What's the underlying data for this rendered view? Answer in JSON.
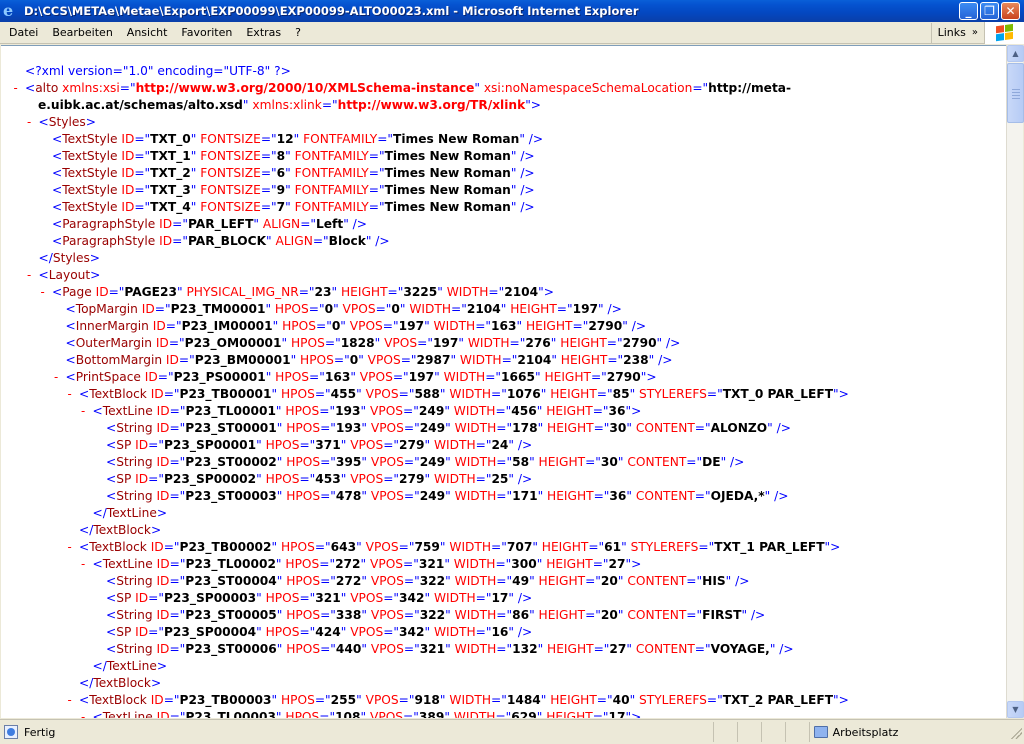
{
  "window": {
    "title": "D:\\CCS\\METAe\\Metae\\Export\\EXP00099\\EXP00099-ALTO00023.xml - Microsoft Internet Explorer",
    "minimize": "_",
    "maximize": "❐",
    "close": "✕"
  },
  "menu": {
    "items": [
      "Datei",
      "Bearbeiten",
      "Ansicht",
      "Favoriten",
      "Extras",
      "?"
    ],
    "links": "Links",
    "links_chevron": "»"
  },
  "status": {
    "text": "Fertig",
    "zone": "Arbeitsplatz"
  },
  "colors": {
    "tag_name": "#990000",
    "attr_name": "#ff0000",
    "markup": "#0000ff",
    "collapse_marker": "#ff0000"
  },
  "xml_lines": [
    {
      "indent": 0,
      "marker": "",
      "kind": "pi",
      "text": "<?xml version=\"1.0\" encoding=\"UTF-8\" ?>"
    },
    {
      "indent": 0,
      "marker": "-",
      "kind": "alto1",
      "text": "alto"
    },
    {
      "indent": 0,
      "marker": "",
      "kind": "alto2",
      "text": ""
    },
    {
      "indent": 1,
      "marker": "-",
      "kind": "open",
      "tag": "Styles",
      "attrs": []
    },
    {
      "indent": 2,
      "marker": "",
      "kind": "empty",
      "tag": "TextStyle",
      "attrs": [
        [
          "ID",
          "TXT_0"
        ],
        [
          "FONTSIZE",
          "12"
        ],
        [
          "FONTFAMILY",
          "Times New Roman"
        ]
      ]
    },
    {
      "indent": 2,
      "marker": "",
      "kind": "empty",
      "tag": "TextStyle",
      "attrs": [
        [
          "ID",
          "TXT_1"
        ],
        [
          "FONTSIZE",
          "8"
        ],
        [
          "FONTFAMILY",
          "Times New Roman"
        ]
      ]
    },
    {
      "indent": 2,
      "marker": "",
      "kind": "empty",
      "tag": "TextStyle",
      "attrs": [
        [
          "ID",
          "TXT_2"
        ],
        [
          "FONTSIZE",
          "6"
        ],
        [
          "FONTFAMILY",
          "Times New Roman"
        ]
      ]
    },
    {
      "indent": 2,
      "marker": "",
      "kind": "empty",
      "tag": "TextStyle",
      "attrs": [
        [
          "ID",
          "TXT_3"
        ],
        [
          "FONTSIZE",
          "9"
        ],
        [
          "FONTFAMILY",
          "Times New Roman"
        ]
      ]
    },
    {
      "indent": 2,
      "marker": "",
      "kind": "empty",
      "tag": "TextStyle",
      "attrs": [
        [
          "ID",
          "TXT_4"
        ],
        [
          "FONTSIZE",
          "7"
        ],
        [
          "FONTFAMILY",
          "Times New Roman"
        ]
      ]
    },
    {
      "indent": 2,
      "marker": "",
      "kind": "empty",
      "tag": "ParagraphStyle",
      "attrs": [
        [
          "ID",
          "PAR_LEFT"
        ],
        [
          "ALIGN",
          "Left"
        ]
      ]
    },
    {
      "indent": 2,
      "marker": "",
      "kind": "empty",
      "tag": "ParagraphStyle",
      "attrs": [
        [
          "ID",
          "PAR_BLOCK"
        ],
        [
          "ALIGN",
          "Block"
        ]
      ]
    },
    {
      "indent": 1,
      "marker": "",
      "kind": "close",
      "tag": "Styles"
    },
    {
      "indent": 1,
      "marker": "-",
      "kind": "open",
      "tag": "Layout",
      "attrs": []
    },
    {
      "indent": 2,
      "marker": "-",
      "kind": "open",
      "tag": "Page",
      "attrs": [
        [
          "ID",
          "PAGE23"
        ],
        [
          "PHYSICAL_IMG_NR",
          "23"
        ],
        [
          "HEIGHT",
          "3225"
        ],
        [
          "WIDTH",
          "2104"
        ]
      ]
    },
    {
      "indent": 3,
      "marker": "",
      "kind": "empty",
      "tag": "TopMargin",
      "attrs": [
        [
          "ID",
          "P23_TM00001"
        ],
        [
          "HPOS",
          "0"
        ],
        [
          "VPOS",
          "0"
        ],
        [
          "WIDTH",
          "2104"
        ],
        [
          "HEIGHT",
          "197"
        ]
      ]
    },
    {
      "indent": 3,
      "marker": "",
      "kind": "empty",
      "tag": "InnerMargin",
      "attrs": [
        [
          "ID",
          "P23_IM00001"
        ],
        [
          "HPOS",
          "0"
        ],
        [
          "VPOS",
          "197"
        ],
        [
          "WIDTH",
          "163"
        ],
        [
          "HEIGHT",
          "2790"
        ]
      ]
    },
    {
      "indent": 3,
      "marker": "",
      "kind": "empty",
      "tag": "OuterMargin",
      "attrs": [
        [
          "ID",
          "P23_OM00001"
        ],
        [
          "HPOS",
          "1828"
        ],
        [
          "VPOS",
          "197"
        ],
        [
          "WIDTH",
          "276"
        ],
        [
          "HEIGHT",
          "2790"
        ]
      ]
    },
    {
      "indent": 3,
      "marker": "",
      "kind": "empty",
      "tag": "BottomMargin",
      "attrs": [
        [
          "ID",
          "P23_BM00001"
        ],
        [
          "HPOS",
          "0"
        ],
        [
          "VPOS",
          "2987"
        ],
        [
          "WIDTH",
          "2104"
        ],
        [
          "HEIGHT",
          "238"
        ]
      ]
    },
    {
      "indent": 3,
      "marker": "-",
      "kind": "open",
      "tag": "PrintSpace",
      "attrs": [
        [
          "ID",
          "P23_PS00001"
        ],
        [
          "HPOS",
          "163"
        ],
        [
          "VPOS",
          "197"
        ],
        [
          "WIDTH",
          "1665"
        ],
        [
          "HEIGHT",
          "2790"
        ]
      ]
    },
    {
      "indent": 4,
      "marker": "-",
      "kind": "open",
      "tag": "TextBlock",
      "attrs": [
        [
          "ID",
          "P23_TB00001"
        ],
        [
          "HPOS",
          "455"
        ],
        [
          "VPOS",
          "588"
        ],
        [
          "WIDTH",
          "1076"
        ],
        [
          "HEIGHT",
          "85"
        ],
        [
          "STYLEREFS",
          "TXT_0 PAR_LEFT"
        ]
      ]
    },
    {
      "indent": 5,
      "marker": "-",
      "kind": "open",
      "tag": "TextLine",
      "attrs": [
        [
          "ID",
          "P23_TL00001"
        ],
        [
          "HPOS",
          "193"
        ],
        [
          "VPOS",
          "249"
        ],
        [
          "WIDTH",
          "456"
        ],
        [
          "HEIGHT",
          "36"
        ]
      ]
    },
    {
      "indent": 6,
      "marker": "",
      "kind": "empty",
      "tag": "String",
      "attrs": [
        [
          "ID",
          "P23_ST00001"
        ],
        [
          "HPOS",
          "193"
        ],
        [
          "VPOS",
          "249"
        ],
        [
          "WIDTH",
          "178"
        ],
        [
          "HEIGHT",
          "30"
        ],
        [
          "CONTENT",
          "ALONZO"
        ]
      ]
    },
    {
      "indent": 6,
      "marker": "",
      "kind": "empty",
      "tag": "SP",
      "attrs": [
        [
          "ID",
          "P23_SP00001"
        ],
        [
          "HPOS",
          "371"
        ],
        [
          "VPOS",
          "279"
        ],
        [
          "WIDTH",
          "24"
        ]
      ]
    },
    {
      "indent": 6,
      "marker": "",
      "kind": "empty",
      "tag": "String",
      "attrs": [
        [
          "ID",
          "P23_ST00002"
        ],
        [
          "HPOS",
          "395"
        ],
        [
          "VPOS",
          "249"
        ],
        [
          "WIDTH",
          "58"
        ],
        [
          "HEIGHT",
          "30"
        ],
        [
          "CONTENT",
          "DE"
        ]
      ]
    },
    {
      "indent": 6,
      "marker": "",
      "kind": "empty",
      "tag": "SP",
      "attrs": [
        [
          "ID",
          "P23_SP00002"
        ],
        [
          "HPOS",
          "453"
        ],
        [
          "VPOS",
          "279"
        ],
        [
          "WIDTH",
          "25"
        ]
      ]
    },
    {
      "indent": 6,
      "marker": "",
      "kind": "empty",
      "tag": "String",
      "attrs": [
        [
          "ID",
          "P23_ST00003"
        ],
        [
          "HPOS",
          "478"
        ],
        [
          "VPOS",
          "249"
        ],
        [
          "WIDTH",
          "171"
        ],
        [
          "HEIGHT",
          "36"
        ],
        [
          "CONTENT",
          "OJEDA,*"
        ]
      ]
    },
    {
      "indent": 5,
      "marker": "",
      "kind": "close",
      "tag": "TextLine"
    },
    {
      "indent": 4,
      "marker": "",
      "kind": "close",
      "tag": "TextBlock"
    },
    {
      "indent": 4,
      "marker": "-",
      "kind": "open",
      "tag": "TextBlock",
      "attrs": [
        [
          "ID",
          "P23_TB00002"
        ],
        [
          "HPOS",
          "643"
        ],
        [
          "VPOS",
          "759"
        ],
        [
          "WIDTH",
          "707"
        ],
        [
          "HEIGHT",
          "61"
        ],
        [
          "STYLEREFS",
          "TXT_1 PAR_LEFT"
        ]
      ]
    },
    {
      "indent": 5,
      "marker": "-",
      "kind": "open",
      "tag": "TextLine",
      "attrs": [
        [
          "ID",
          "P23_TL00002"
        ],
        [
          "HPOS",
          "272"
        ],
        [
          "VPOS",
          "321"
        ],
        [
          "WIDTH",
          "300"
        ],
        [
          "HEIGHT",
          "27"
        ]
      ]
    },
    {
      "indent": 6,
      "marker": "",
      "kind": "empty",
      "tag": "String",
      "attrs": [
        [
          "ID",
          "P23_ST00004"
        ],
        [
          "HPOS",
          "272"
        ],
        [
          "VPOS",
          "322"
        ],
        [
          "WIDTH",
          "49"
        ],
        [
          "HEIGHT",
          "20"
        ],
        [
          "CONTENT",
          "HIS"
        ]
      ]
    },
    {
      "indent": 6,
      "marker": "",
      "kind": "empty",
      "tag": "SP",
      "attrs": [
        [
          "ID",
          "P23_SP00003"
        ],
        [
          "HPOS",
          "321"
        ],
        [
          "VPOS",
          "342"
        ],
        [
          "WIDTH",
          "17"
        ]
      ]
    },
    {
      "indent": 6,
      "marker": "",
      "kind": "empty",
      "tag": "String",
      "attrs": [
        [
          "ID",
          "P23_ST00005"
        ],
        [
          "HPOS",
          "338"
        ],
        [
          "VPOS",
          "322"
        ],
        [
          "WIDTH",
          "86"
        ],
        [
          "HEIGHT",
          "20"
        ],
        [
          "CONTENT",
          "FIRST"
        ]
      ]
    },
    {
      "indent": 6,
      "marker": "",
      "kind": "empty",
      "tag": "SP",
      "attrs": [
        [
          "ID",
          "P23_SP00004"
        ],
        [
          "HPOS",
          "424"
        ],
        [
          "VPOS",
          "342"
        ],
        [
          "WIDTH",
          "16"
        ]
      ]
    },
    {
      "indent": 6,
      "marker": "",
      "kind": "empty",
      "tag": "String",
      "attrs": [
        [
          "ID",
          "P23_ST00006"
        ],
        [
          "HPOS",
          "440"
        ],
        [
          "VPOS",
          "321"
        ],
        [
          "WIDTH",
          "132"
        ],
        [
          "HEIGHT",
          "27"
        ],
        [
          "CONTENT",
          "VOYAGE,"
        ]
      ]
    },
    {
      "indent": 5,
      "marker": "",
      "kind": "close",
      "tag": "TextLine"
    },
    {
      "indent": 4,
      "marker": "",
      "kind": "close",
      "tag": "TextBlock"
    },
    {
      "indent": 4,
      "marker": "-",
      "kind": "open",
      "tag": "TextBlock",
      "attrs": [
        [
          "ID",
          "P23_TB00003"
        ],
        [
          "HPOS",
          "255"
        ],
        [
          "VPOS",
          "918"
        ],
        [
          "WIDTH",
          "1484"
        ],
        [
          "HEIGHT",
          "40"
        ],
        [
          "STYLEREFS",
          "TXT_2 PAR_LEFT"
        ]
      ]
    },
    {
      "indent": 5,
      "marker": "-",
      "kind": "open",
      "tag": "TextLine",
      "attrs": [
        [
          "ID",
          "P23_TL00003"
        ],
        [
          "HPOS",
          "108"
        ],
        [
          "VPOS",
          "389"
        ],
        [
          "WIDTH",
          "629"
        ],
        [
          "HEIGHT",
          "17"
        ]
      ]
    }
  ],
  "alto_root": {
    "xsi_attr": "xmlns:xsi",
    "xsi_val": "http://www.w3.org/2000/10/XMLSchema-instance",
    "nsl_attr": "xsi:noNamespaceSchemaLocation",
    "nsl_val_1": "http://meta-",
    "nsl_val_2": "e.uibk.ac.at/schemas/alto.xsd",
    "xlink_attr": "xmlns:xlink",
    "xlink_val": "http://www.w3.org/TR/xlink"
  }
}
